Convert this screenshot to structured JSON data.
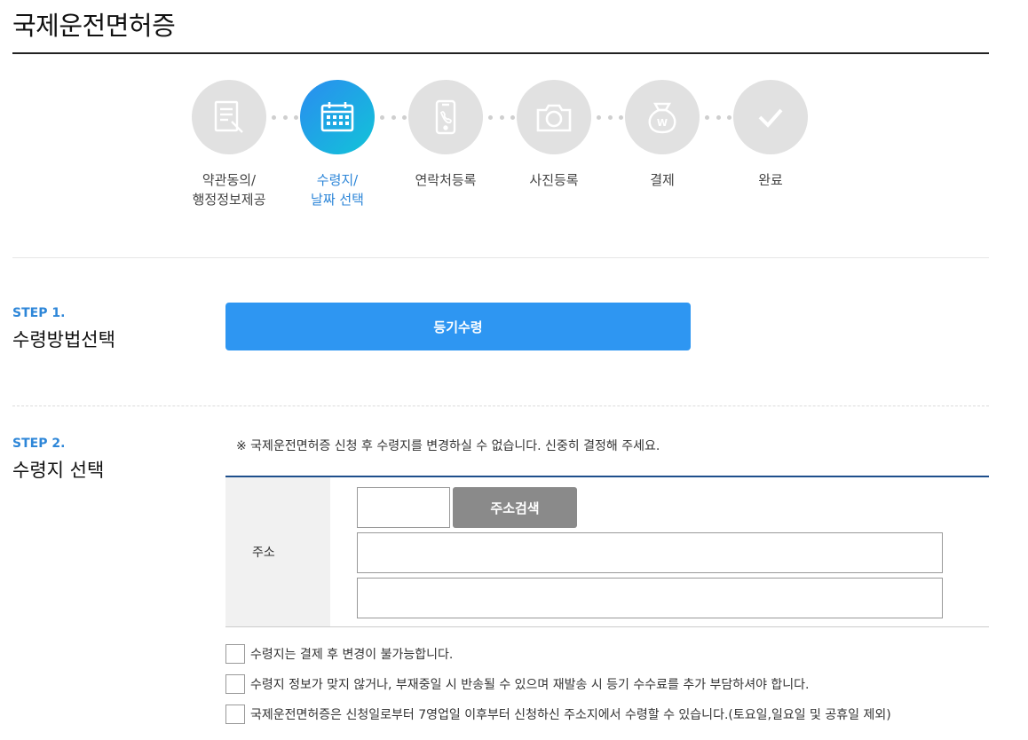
{
  "page": {
    "title": "국제운전면허증"
  },
  "progress": {
    "steps": [
      {
        "line1": "약관동의/",
        "line2": "행정정보제공",
        "icon": "document-pen-icon",
        "active": false
      },
      {
        "line1": "수령지/",
        "line2": "날짜 선택",
        "icon": "calendar-icon",
        "active": true
      },
      {
        "line1": "연락처등록",
        "line2": "",
        "icon": "phone-icon",
        "active": false
      },
      {
        "line1": "사진등록",
        "line2": "",
        "icon": "camera-icon",
        "active": false
      },
      {
        "line1": "결제",
        "line2": "",
        "icon": "money-bag-icon",
        "active": false
      },
      {
        "line1": "완료",
        "line2": "",
        "icon": "check-icon",
        "active": false
      }
    ]
  },
  "step1": {
    "num": "STEP 1.",
    "title": "수령방법선택",
    "button": "등기수령"
  },
  "step2": {
    "num": "STEP 2.",
    "title": "수령지 선택",
    "notice": "※ 국제운전면허증 신청 후 수령지를 변경하실 수 없습니다. 신중히 결정해 주세요.",
    "address_label": "주소",
    "search_button": "주소검색",
    "zip_value": "",
    "addr1_value": "",
    "addr2_value": ""
  },
  "agreements": [
    "수령지는 결제 후 변경이 불가능합니다.",
    "수령지 정보가 맞지 않거나, 부재중일 시 반송될 수 있으며 재발송 시 등기 수수료를 추가 부담하셔야 합니다.",
    "국제운전면허증은 신청일로부터 7영업일 이후부터 신청하신 주소지에서 수령할 수 있습니다.(토요일,일요일 및 공휴일 제외)"
  ],
  "colors": {
    "accent": "#2d86d8",
    "button": "#2e96f2",
    "inactive_step": "#e1e1e1",
    "table_border": "#1e4f8c"
  }
}
